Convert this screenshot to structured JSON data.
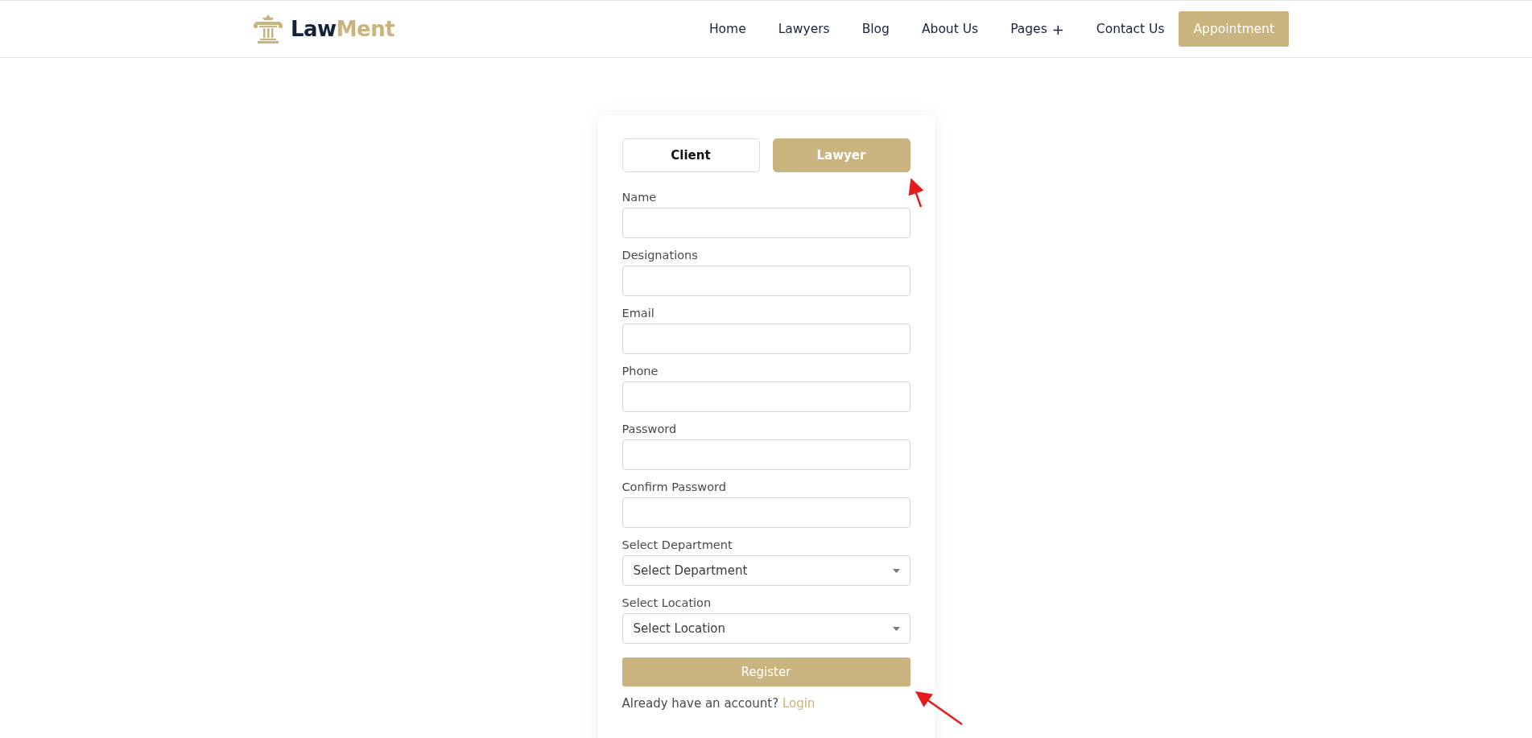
{
  "logo": {
    "primary": "Law",
    "accent": "Ment"
  },
  "nav": [
    {
      "kind": "link",
      "label": "Home"
    },
    {
      "kind": "link",
      "label": "Lawyers"
    },
    {
      "kind": "link",
      "label": "Blog"
    },
    {
      "kind": "link",
      "label": "About Us"
    },
    {
      "kind": "dropdown",
      "label": "Pages",
      "toggle": "+"
    },
    {
      "kind": "link",
      "label": "Contact Us"
    },
    {
      "kind": "button",
      "label": "Appointment"
    }
  ],
  "tabs": [
    {
      "label": "Client",
      "selected": false
    },
    {
      "label": "Lawyer",
      "selected": true
    }
  ],
  "fields": [
    {
      "kind": "text",
      "label": "Name"
    },
    {
      "kind": "text",
      "label": "Designations"
    },
    {
      "kind": "text",
      "label": "Email"
    },
    {
      "kind": "text",
      "label": "Phone"
    },
    {
      "kind": "text",
      "label": "Password"
    },
    {
      "kind": "text",
      "label": "Confirm Password"
    },
    {
      "kind": "select",
      "label": "Select Department",
      "value": "Select Department"
    },
    {
      "kind": "select",
      "label": "Select Location",
      "value": "Select Location"
    }
  ],
  "submit": "Register",
  "footer": {
    "text": "Already have an account?",
    "link": "Login"
  }
}
